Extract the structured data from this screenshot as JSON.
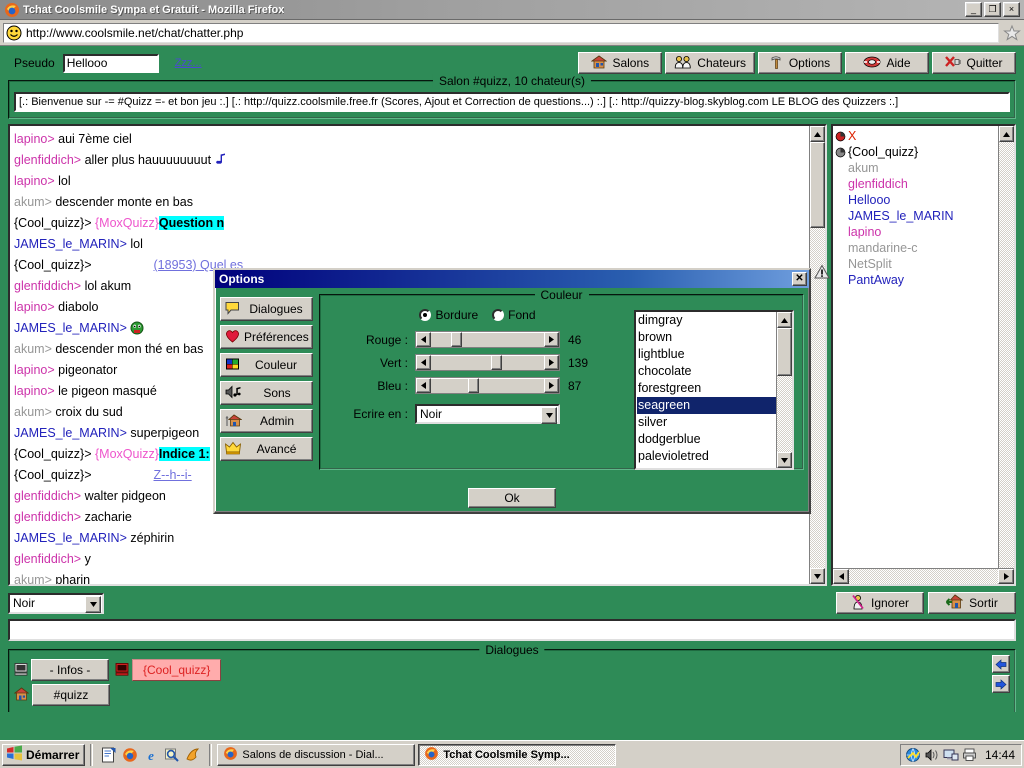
{
  "browser": {
    "title": "Tchat Coolsmile Sympa et Gratuit - Mozilla Firefox",
    "url": "http://www.coolsmile.net/chat/chatter.php",
    "minimize_label": "_",
    "restore_label": "❐",
    "close_label": "×"
  },
  "chat_app": {
    "pseudo_label": "Pseudo",
    "pseudo_value": "Hellooo",
    "zzz_link": "Zzz...",
    "toolbar": [
      {
        "label": "Salons",
        "icon": "house-icon"
      },
      {
        "label": "Chateurs",
        "icon": "people-icon"
      },
      {
        "label": "Options",
        "icon": "hammer-icon"
      },
      {
        "label": "Aide",
        "icon": "lifebuoy-icon"
      },
      {
        "label": "Quitter",
        "icon": "unplug-icon"
      }
    ],
    "salon_legend": "Salon #quizz, 10 chateur(s)",
    "topic": "[.: Bienvenue sur -= #Quizz =- et bon jeu :.] [.:  http://quizz.coolsmile.free.fr (Scores, Ajout et Correction de questions...) :.] [.: http://quizzy-blog.skyblog.com LE BLOG des Quizzers :.]",
    "messages": [
      {
        "nick": "lapino",
        "nick_class": "nick-pink",
        "text": "aui 7ème ciel"
      },
      {
        "nick": "glenfiddich",
        "nick_class": "nick-pink",
        "text": "aller plus hauuuuuuuut",
        "emoji": "note"
      },
      {
        "nick": "lapino",
        "nick_class": "nick-pink",
        "text": "lol"
      },
      {
        "nick": "akum",
        "nick_class": "nick-gray",
        "text": "descender monte en bas"
      },
      {
        "nick": "{Cool_quizz}",
        "nick_class": "nick-dgray",
        "bot_prefix": "{MoxQuizz}",
        "highlight": "Question n",
        "text": ""
      },
      {
        "nick": "JAMES_le_MARIN",
        "nick_class": "nick-blue",
        "text": "lol"
      },
      {
        "nick": "{Cool_quizz}",
        "nick_class": "nick-dgray",
        "indent": true,
        "link": "(18953) Quel es",
        "text": ""
      },
      {
        "nick": "glenfiddich",
        "nick_class": "nick-pink",
        "text": "lol akum"
      },
      {
        "nick": "lapino",
        "nick_class": "nick-pink",
        "text": "diabolo"
      },
      {
        "nick": "JAMES_le_MARIN",
        "nick_class": "nick-blue",
        "text": "",
        "emoji": "smiley"
      },
      {
        "nick": "akum",
        "nick_class": "nick-gray",
        "text": "descender mon thé en bas"
      },
      {
        "nick": "lapino",
        "nick_class": "nick-pink",
        "text": "pigeonator"
      },
      {
        "nick": "lapino",
        "nick_class": "nick-pink",
        "text": "le pigeon masqué"
      },
      {
        "nick": "akum",
        "nick_class": "nick-gray",
        "text": "croix du sud"
      },
      {
        "nick": "JAMES_le_MARIN",
        "nick_class": "nick-blue",
        "text": "superpigeon"
      },
      {
        "nick": "{Cool_quizz}",
        "nick_class": "nick-dgray",
        "bot_prefix": "{MoxQuizz}",
        "highlight": "Indice 1:",
        "text": ""
      },
      {
        "nick": "{Cool_quizz}",
        "nick_class": "nick-dgray",
        "indent": true,
        "link": "Z--h--i-",
        "text": ""
      },
      {
        "nick": "glenfiddich",
        "nick_class": "nick-pink",
        "text": "walter pidgeon"
      },
      {
        "nick": "glenfiddich",
        "nick_class": "nick-pink",
        "text": "zacharie"
      },
      {
        "nick": "JAMES_le_MARIN",
        "nick_class": "nick-blue",
        "text": "zéphirin"
      },
      {
        "nick": "glenfiddich",
        "nick_class": "nick-pink",
        "text": "y"
      },
      {
        "nick": "akum",
        "nick_class": "nick-gray",
        "text": "pharin"
      }
    ],
    "users": [
      {
        "name": "X",
        "class": "u-red",
        "icon": "op-icon"
      },
      {
        "name": "{Cool_quizz}",
        "class": "u-black",
        "icon": "op-icon"
      },
      {
        "name": "akum",
        "class": "u-gray",
        "icon": ""
      },
      {
        "name": "glenfiddich",
        "class": "u-pink",
        "icon": ""
      },
      {
        "name": "Hellooo",
        "class": "u-blue",
        "icon": ""
      },
      {
        "name": "JAMES_le_MARIN",
        "class": "u-blue",
        "icon": ""
      },
      {
        "name": "lapino",
        "class": "u-pink",
        "icon": ""
      },
      {
        "name": "mandarine-c",
        "class": "u-gray",
        "icon": ""
      },
      {
        "name": "NetSplit",
        "class": "u-gray",
        "icon": ""
      },
      {
        "name": "PantAway",
        "class": "u-blue",
        "icon": ""
      }
    ],
    "color_select_value": "Noir",
    "message_input_value": "",
    "message_input_placeholder": "",
    "ignore_button": "Ignorer",
    "exit_button": "Sortir",
    "dialogues_legend": "Dialogues",
    "dialog_tabs": [
      {
        "label": "- Infos -",
        "icon": "console-icon",
        "active": false
      },
      {
        "label": "{Cool_quizz}",
        "icon": "query-icon",
        "active": true
      },
      {
        "label": "#quizz",
        "icon": "channel-icon",
        "active": false
      }
    ]
  },
  "options_dialog": {
    "title": "Options",
    "close_label": "✕",
    "sidebar": [
      {
        "label": "Dialogues",
        "icon": "speech-bubble-icon"
      },
      {
        "label": "Préférences",
        "icon": "heart-icon"
      },
      {
        "label": "Couleur",
        "icon": "palette-icon"
      },
      {
        "label": "Sons",
        "icon": "speaker-icon"
      },
      {
        "label": "Admin",
        "icon": "house-tools-icon"
      },
      {
        "label": "Avancé",
        "icon": "crown-icon"
      }
    ],
    "group_legend": "Couleur",
    "radio_bordure": "Bordure",
    "radio_fond": "Fond",
    "radio_selected": "Bordure",
    "sliders": [
      {
        "label": "Rouge :",
        "value": 46
      },
      {
        "label": "Vert :",
        "value": 139
      },
      {
        "label": "Bleu :",
        "value": 87
      }
    ],
    "ecrire_label": "Ecrire en :",
    "ecrire_value": "Noir",
    "color_list": [
      "dimgray",
      "brown",
      "lightblue",
      "chocolate",
      "forestgreen",
      "seagreen",
      "silver",
      "dodgerblue",
      "palevioletred"
    ],
    "color_selected": "seagreen",
    "ok_button": "Ok"
  },
  "taskbar": {
    "start_label": "Démarrer",
    "quicklaunch": [
      "show-desktop-icon",
      "firefox-icon",
      "ie-icon",
      "search-icon",
      "media-icon"
    ],
    "tasks": [
      {
        "label": "Salons de discussion - Dial...",
        "active": false,
        "icon": "firefox-icon"
      },
      {
        "label": "Tchat Coolsmile Symp...",
        "active": true,
        "icon": "firefox-icon"
      }
    ],
    "tray_icons": [
      "network-icon",
      "volume-icon",
      "monitor-icon",
      "printer-icon"
    ],
    "clock": "14:44"
  },
  "colors": {
    "app_bg": "#2e8b57",
    "dialog_title": "#00007c",
    "highlight_cyan": "#00ffff",
    "selection_blue": "#10246b"
  }
}
